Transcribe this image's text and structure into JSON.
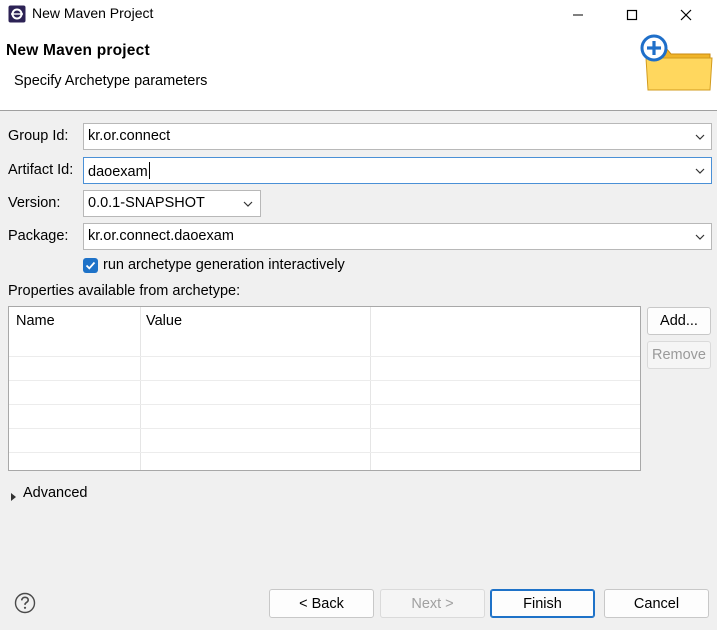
{
  "window": {
    "title": "New Maven Project"
  },
  "header": {
    "title": "New Maven project",
    "subtitle": "Specify Archetype parameters",
    "icon": "new-folder-plus-icon"
  },
  "form": {
    "group_id": {
      "label": "Group Id:",
      "value": "kr.or.connect"
    },
    "artifact_id": {
      "label": "Artifact Id:",
      "value": "daoexam"
    },
    "version": {
      "label": "Version:",
      "value": "0.0.1-SNAPSHOT"
    },
    "package": {
      "label": "Package:",
      "value": "kr.or.connect.daoexam"
    },
    "interactive": {
      "label": "run archetype generation interactively",
      "checked": true
    }
  },
  "properties": {
    "label": "Properties available from archetype:",
    "columns": [
      "Name",
      "Value"
    ],
    "rows": [],
    "add_label": "Add...",
    "remove_label": "Remove"
  },
  "advanced": {
    "label": "Advanced"
  },
  "footer": {
    "back": "< Back",
    "next": "Next >",
    "finish": "Finish",
    "cancel": "Cancel"
  },
  "colors": {
    "accent": "#1e72c8",
    "focus": "#4a90d6",
    "background": "#f0f0f0"
  }
}
